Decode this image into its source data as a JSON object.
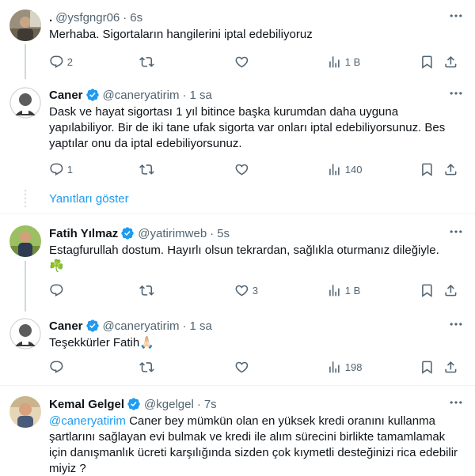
{
  "tweets": [
    {
      "name": ".",
      "handle": "@ysfgngr06",
      "time": "6s",
      "text": "Merhaba. Sigortaların hangilerini iptal edebiliyoruz",
      "replies": "2",
      "retweets": "",
      "likes": "",
      "views": "1 B"
    },
    {
      "name": "Caner",
      "handle": "@caneryatirim",
      "time": "1 sa",
      "text": "Dask ve hayat sigortası 1 yıl bitince başka kurumdan daha uygunа yapılabiliyor. Bir de iki tane ufak sigorta var onları iptal edebiliyorsunuz. Bes yaptılar onu da iptal edebiliyorsunuz.",
      "replies": "1",
      "retweets": "",
      "likes": "",
      "views": "140"
    },
    {
      "name": "Fatih Yılmaz",
      "handle": "@yatirimweb",
      "time": "5s",
      "text": "Estagfurullah dostum. Hayırlı olsun tekrardan, sağlıkla oturmanız dileğiyle.",
      "emoji": "☘️",
      "replies": "",
      "retweets": "",
      "likes": "3",
      "views": "1 B"
    },
    {
      "name": "Caner",
      "handle": "@caneryatirim",
      "time": "1 sa",
      "text": "Teşekkürler Fatih",
      "emoji": "🙏🏻",
      "replies": "",
      "retweets": "",
      "likes": "",
      "views": "198"
    },
    {
      "name": "Kemal Gelgel",
      "handle": "@kgelgel",
      "time": "7s",
      "mention": "@caneryatirim",
      "text": " Caner bey mümkün olan en yüksek kredi oranını kullanma şartlarını  sağlayan evi bulmak ve kredi ile alım sürecini birlikte tamamlamak için danışmanlık ücreti karşılığında sizden çok kıymetli desteğinizi rica edebilir miyiz ?"
    }
  ],
  "show_replies": "Yanıtları göster",
  "colors": {
    "accent": "#1d9bf0",
    "muted": "#536471",
    "text": "#0f1419",
    "divider": "#eff3f4"
  }
}
